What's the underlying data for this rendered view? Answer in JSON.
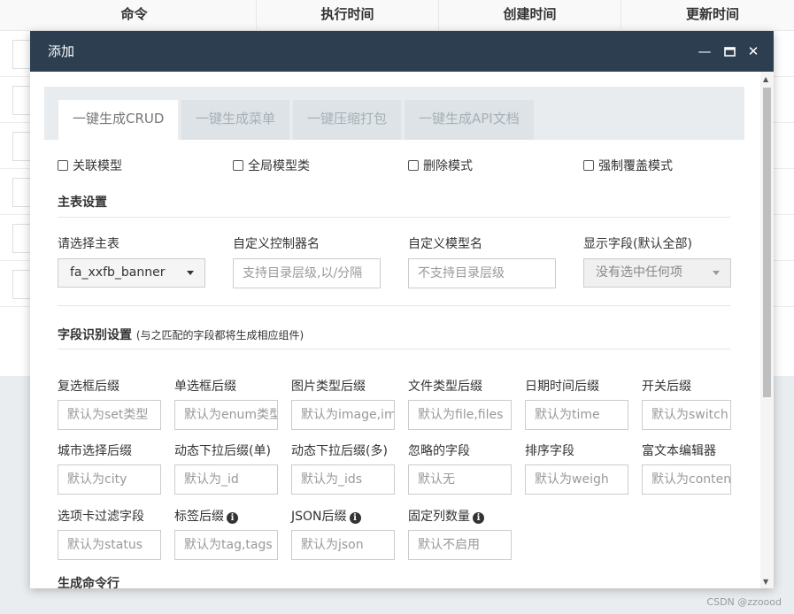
{
  "background_table": {
    "headers": [
      "命令",
      "执行时间",
      "创建时间",
      "更新时间"
    ]
  },
  "modal": {
    "title": "添加",
    "controls": {
      "minimize": "—",
      "maximize": "❐",
      "close": "✕"
    }
  },
  "tabs": [
    "一键生成CRUD",
    "一键生成菜单",
    "一键压缩打包",
    "一键生成API文档"
  ],
  "options": [
    "关联模型",
    "全局模型类",
    "删除模式",
    "强制覆盖模式"
  ],
  "main_table": {
    "title": "主表设置",
    "fields": {
      "main_table_label": "请选择主表",
      "main_table_value": "fa_xxfb_banner",
      "controller_label": "自定义控制器名",
      "controller_placeholder": "支持目录层级,以/分隔",
      "model_label": "自定义模型名",
      "model_placeholder": "不支持目录层级",
      "display_label": "显示字段(默认全部)",
      "display_value": "没有选中任何项"
    }
  },
  "field_recognition": {
    "title": "字段识别设置",
    "subtitle": "(与之匹配的字段都将生成相应组件)",
    "rows": [
      [
        {
          "label": "复选框后缀",
          "placeholder": "默认为set类型"
        },
        {
          "label": "单选框后缀",
          "placeholder": "默认为enum类型"
        },
        {
          "label": "图片类型后缀",
          "placeholder": "默认为image,images"
        },
        {
          "label": "文件类型后缀",
          "placeholder": "默认为file,files"
        },
        {
          "label": "日期时间后缀",
          "placeholder": "默认为time"
        },
        {
          "label": "开关后缀",
          "placeholder": "默认为switch"
        }
      ],
      [
        {
          "label": "城市选择后缀",
          "placeholder": "默认为city"
        },
        {
          "label": "动态下拉后缀(单)",
          "placeholder": "默认为_id"
        },
        {
          "label": "动态下拉后缀(多)",
          "placeholder": "默认为_ids"
        },
        {
          "label": "忽略的字段",
          "placeholder": "默认无"
        },
        {
          "label": "排序字段",
          "placeholder": "默认为weigh"
        },
        {
          "label": "富文本编辑器",
          "placeholder": "默认为content"
        }
      ],
      [
        {
          "label": "选项卡过滤字段",
          "placeholder": "默认为status"
        },
        {
          "label": "标签后缀",
          "placeholder": "默认为tag,tags"
        },
        {
          "label": "JSON后缀",
          "placeholder": "默认为json"
        },
        {
          "label": "固定列数量",
          "placeholder": "默认不启用"
        }
      ]
    ]
  },
  "command_section": {
    "title": "生成命令行"
  },
  "watermark": "CSDN @zzoood"
}
